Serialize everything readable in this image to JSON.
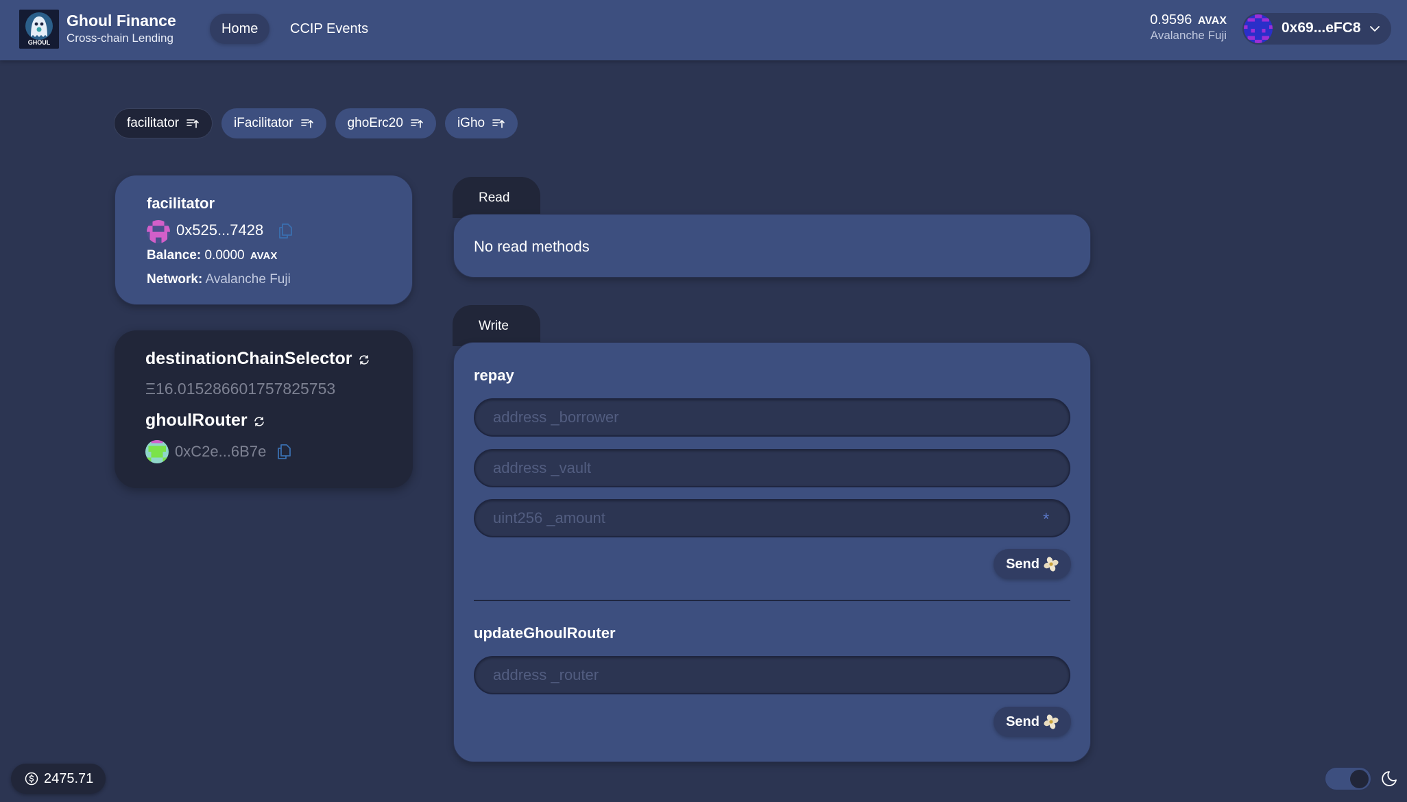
{
  "header": {
    "app_title": "Ghoul Finance",
    "app_subtitle": "Cross-chain Lending",
    "logo_text": "GHOUL",
    "nav": [
      {
        "label": "Home",
        "active": true
      },
      {
        "label": "CCIP Events",
        "active": false
      }
    ],
    "balance_amount": "0.9596",
    "balance_unit": "AVAX",
    "network": "Avalanche Fuji",
    "wallet_address": "0x69...eFC8"
  },
  "contract_tabs": [
    {
      "label": "facilitator",
      "active": true
    },
    {
      "label": "iFacilitator",
      "active": false
    },
    {
      "label": "ghoErc20",
      "active": false
    },
    {
      "label": "iGho",
      "active": false
    }
  ],
  "contract_info": {
    "name": "facilitator",
    "address": "0x525...7428",
    "balance_label": "Balance:",
    "balance_value": "0.0000",
    "balance_unit": "AVAX",
    "network_label": "Network:",
    "network_value": "Avalanche Fuji"
  },
  "variables": [
    {
      "name": "destinationChainSelector",
      "value": "Ξ16.015286601757825753"
    },
    {
      "name": "ghoulRouter",
      "value": "0xC2e...6B7e"
    }
  ],
  "read": {
    "tab_label": "Read",
    "empty_text": "No read methods"
  },
  "write": {
    "tab_label": "Write",
    "methods": [
      {
        "name": "repay",
        "inputs": [
          {
            "placeholder": "address _borrower",
            "value": ""
          },
          {
            "placeholder": "address _vault",
            "value": ""
          },
          {
            "placeholder": "uint256 _amount",
            "value": "",
            "suffix": "*"
          }
        ],
        "send_label": "Send"
      },
      {
        "name": "updateGhoulRouter",
        "inputs": [
          {
            "placeholder": "address _router",
            "value": ""
          }
        ],
        "send_label": "Send"
      }
    ]
  },
  "footer": {
    "native_price": "2475.71",
    "theme": "dark"
  },
  "colors": {
    "background": "#2c3552",
    "header": "#3d4f7f",
    "card": "#3d4f7f",
    "card_dark": "#212639",
    "accent_copy": "#3a6fb0"
  }
}
